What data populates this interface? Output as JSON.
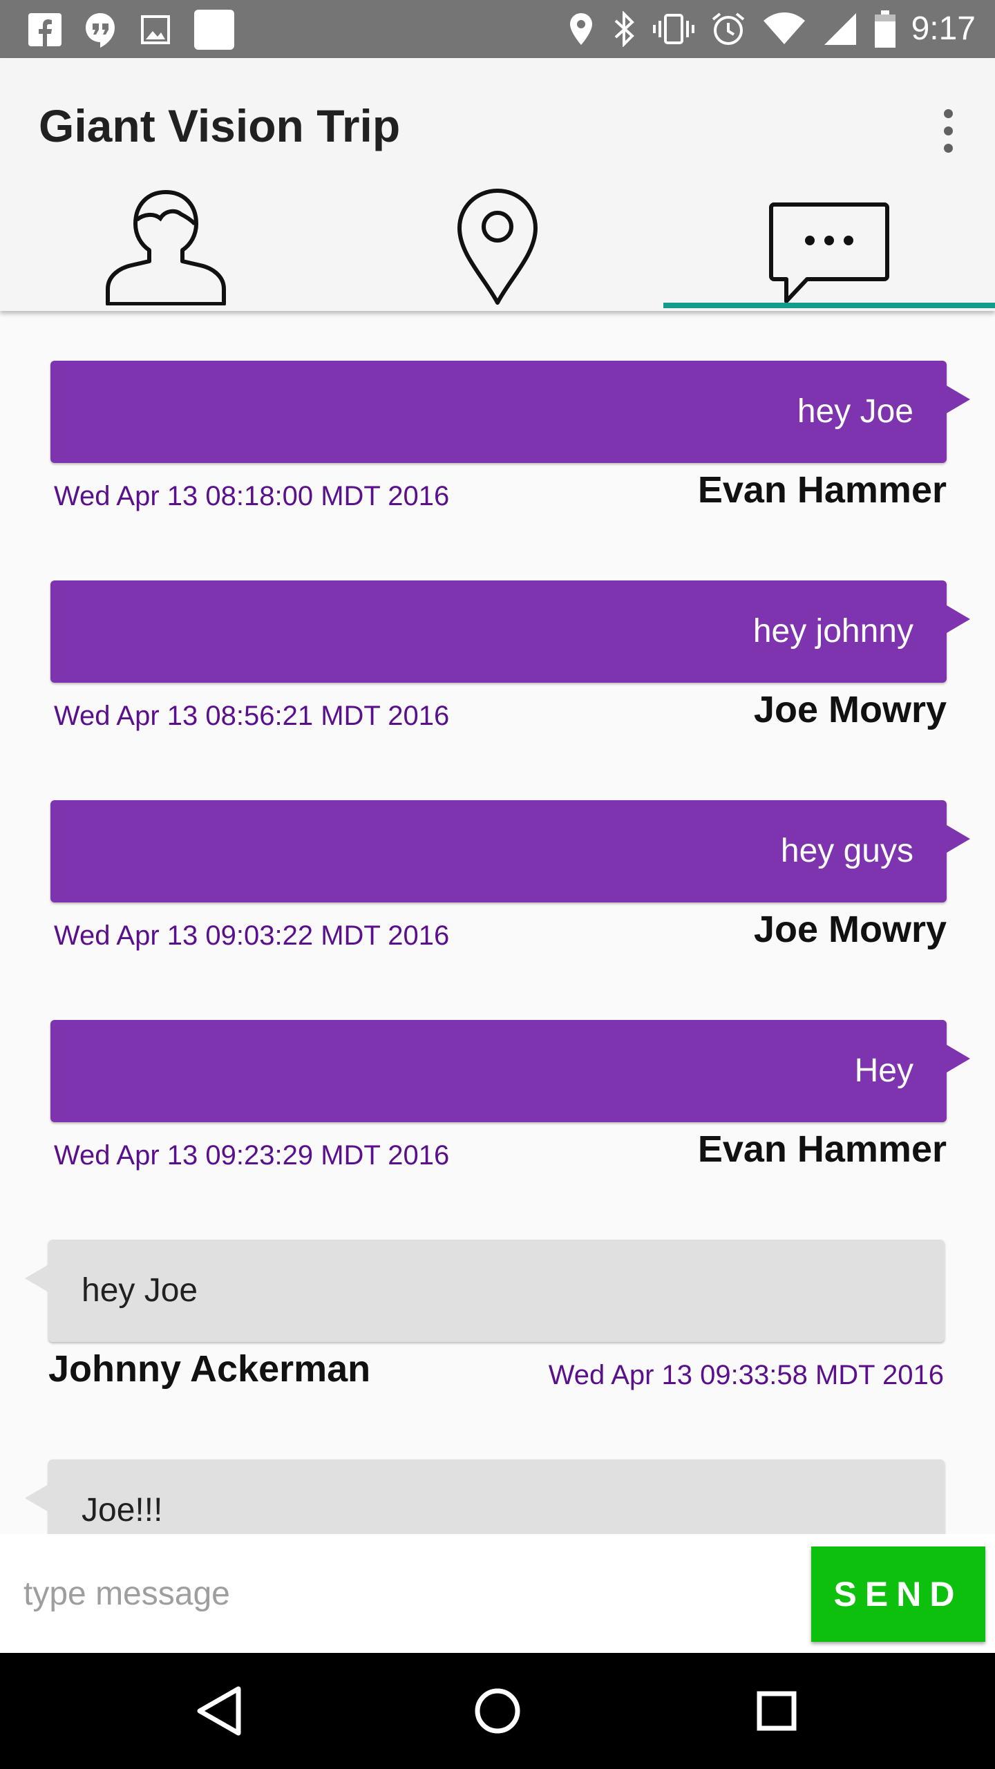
{
  "status_bar": {
    "time": "9:17",
    "left_icons": [
      "facebook-icon",
      "hangouts-icon",
      "image-icon",
      "square-notification-icon"
    ],
    "right_icons": [
      "location-icon",
      "bluetooth-icon",
      "vibrate-icon",
      "alarm-icon",
      "wifi-icon",
      "signal-icon",
      "battery-icon"
    ]
  },
  "app_bar": {
    "title": "Giant Vision Trip",
    "tabs": [
      {
        "icon": "person-icon",
        "selected": false
      },
      {
        "icon": "map-pin-icon",
        "selected": false
      },
      {
        "icon": "chat-bubble-icon",
        "selected": true
      }
    ],
    "accent_color": "#149b8c"
  },
  "colors": {
    "outgoing_bubble": "#7e34ae",
    "incoming_bubble": "#e0e0e0",
    "timestamp": "#5a0f8c",
    "send_button": "#0dc00d"
  },
  "messages": [
    {
      "direction": "out",
      "text": "hey Joe",
      "sender": "Evan Hammer",
      "timestamp": "Wed Apr 13 08:18:00 MDT 2016"
    },
    {
      "direction": "out",
      "text": "hey johnny",
      "sender": "Joe Mowry",
      "timestamp": "Wed Apr 13 08:56:21 MDT 2016"
    },
    {
      "direction": "out",
      "text": "hey guys",
      "sender": "Joe Mowry",
      "timestamp": "Wed Apr 13 09:03:22 MDT 2016"
    },
    {
      "direction": "out",
      "text": "Hey",
      "sender": "Evan Hammer",
      "timestamp": "Wed Apr 13 09:23:29 MDT 2016"
    },
    {
      "direction": "in",
      "text": "hey Joe",
      "sender": "Johnny Ackerman",
      "timestamp": "Wed Apr 13 09:33:58 MDT 2016"
    },
    {
      "direction": "in",
      "text": "Joe!!!",
      "sender": "",
      "timestamp": ""
    }
  ],
  "compose": {
    "value": "",
    "placeholder": "type message",
    "send_label": "SEND"
  },
  "nav_bar": {
    "buttons": [
      "back-icon",
      "home-icon",
      "recents-icon"
    ]
  }
}
